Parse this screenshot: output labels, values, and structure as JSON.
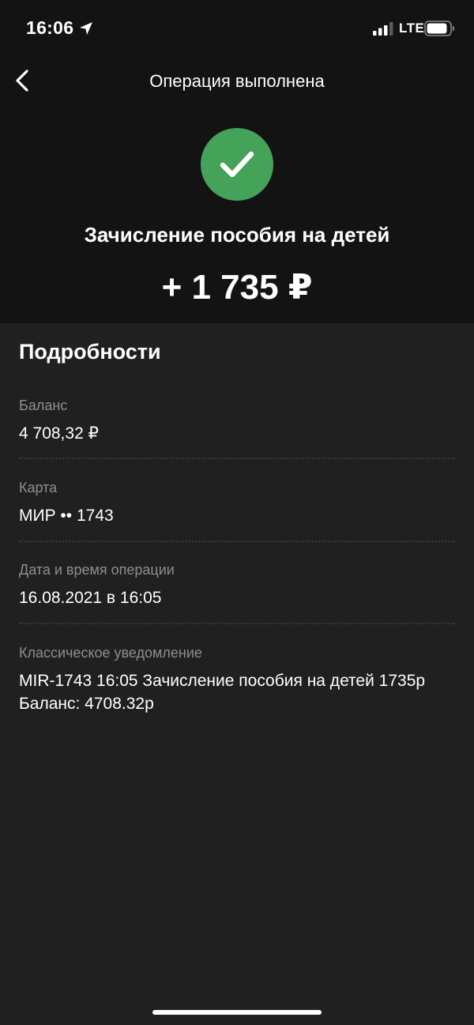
{
  "status_bar": {
    "time": "16:06",
    "network": "LTE",
    "icons": [
      "location-arrow-icon",
      "signal-icon",
      "battery-icon"
    ]
  },
  "nav": {
    "back_icon": "chevron-left-icon",
    "title": "Операция выполнена"
  },
  "operation": {
    "status_icon": "checkmark-icon",
    "status_color": "#45a259",
    "title": "Зачисление пособия на детей",
    "amount": "+ 1 735 ₽"
  },
  "details": {
    "title": "Подробности",
    "items": [
      {
        "label": "Баланс",
        "value": "4 708,32 ₽"
      },
      {
        "label": "Карта",
        "value": "МИР •• 1743"
      },
      {
        "label": "Дата и время операции",
        "value": "16.08.2021 в 16:05"
      },
      {
        "label": "Классическое уведомление",
        "value": "MIR-1743 16:05 Зачисление пособия на детей 1735р Баланс: 4708.32р"
      }
    ]
  },
  "colors": {
    "header_bg": "#131313",
    "body_bg": "#202020",
    "label": "#8e8e8e",
    "accent_green": "#45a259"
  }
}
